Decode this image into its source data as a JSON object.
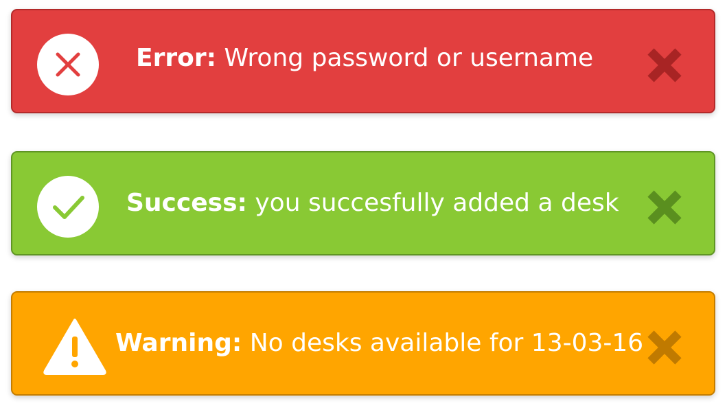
{
  "alerts": [
    {
      "type": "error",
      "label": "Error:",
      "message": "Wrong password or username",
      "icon": "x-circle-icon",
      "close_icon": "close-icon",
      "color": "#e23f3f",
      "close_color": "#a82424"
    },
    {
      "type": "success",
      "label": "Success:",
      "message": "you succesfully added a desk",
      "icon": "check-circle-icon",
      "close_icon": "close-icon",
      "color": "#89c934",
      "close_color": "#5a8f1f"
    },
    {
      "type": "warning",
      "label": "Warning:",
      "message": "No desks available for 13-03-16",
      "icon": "warning-triangle-icon",
      "close_icon": "close-icon",
      "color": "#ffa500",
      "close_color": "#c07a00"
    }
  ]
}
